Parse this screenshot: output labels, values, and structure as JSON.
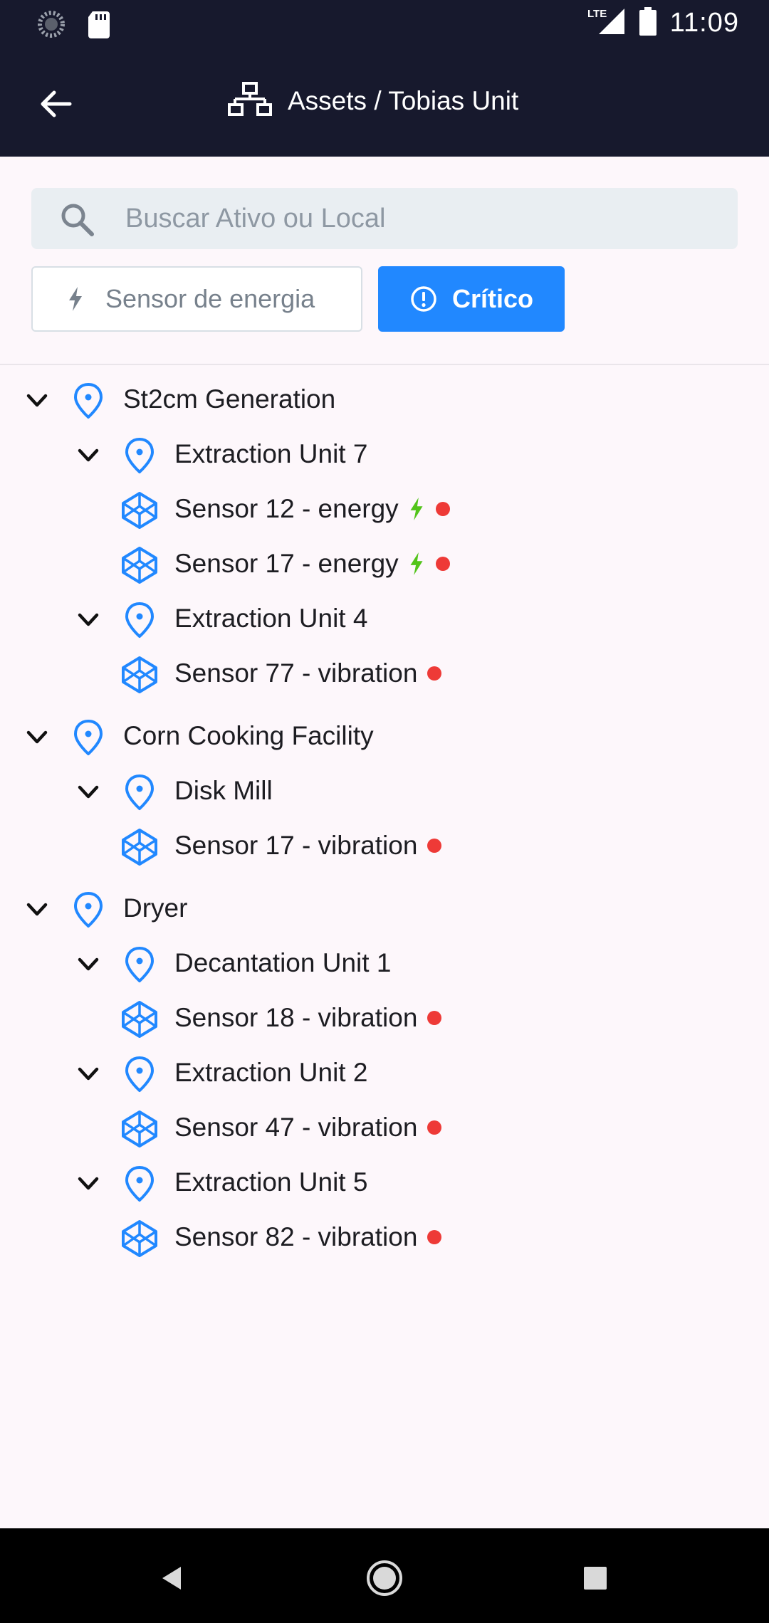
{
  "status_bar": {
    "time": "11:09",
    "network": "LTE",
    "icons": [
      "loading-icon",
      "sd-card-icon",
      "signal-icon",
      "battery-icon"
    ]
  },
  "app_bar": {
    "title": "Assets / Tobias Unit",
    "icons": [
      "back-arrow-icon",
      "hierarchy-icon"
    ]
  },
  "search": {
    "placeholder": "Buscar Ativo ou Local",
    "value": ""
  },
  "filters": {
    "energy_label": "Sensor de energia",
    "critical_label": "Crítico",
    "critical_active": true
  },
  "colors": {
    "header_bg": "#17192d",
    "accent": "#2188ff",
    "alert_red": "#ee3a37",
    "energy_green": "#52c41a",
    "page_bg": "#fdf7fb"
  },
  "tree": [
    {
      "label": "St2cm Generation",
      "type": "location",
      "expanded": true
    },
    {
      "label": "Extraction Unit 7",
      "type": "location",
      "expanded": true
    },
    {
      "label": "Sensor 12 - energy",
      "type": "component",
      "energy": true,
      "critical": true
    },
    {
      "label": "Sensor 17 - energy",
      "type": "component",
      "energy": true,
      "critical": true
    },
    {
      "label": "Extraction Unit 4",
      "type": "location",
      "expanded": true
    },
    {
      "label": "Sensor 77 - vibration",
      "type": "component",
      "energy": false,
      "critical": true
    },
    {
      "label": "Corn Cooking Facility",
      "type": "location",
      "expanded": true
    },
    {
      "label": "Disk Mill",
      "type": "location",
      "expanded": true
    },
    {
      "label": "Sensor 17 - vibration",
      "type": "component",
      "energy": false,
      "critical": true
    },
    {
      "label": "Dryer",
      "type": "location",
      "expanded": true
    },
    {
      "label": "Decantation Unit 1",
      "type": "location",
      "expanded": true
    },
    {
      "label": "Sensor 18 - vibration",
      "type": "component",
      "energy": false,
      "critical": true
    },
    {
      "label": "Extraction Unit 2",
      "type": "location",
      "expanded": true
    },
    {
      "label": "Sensor 47 - vibration",
      "type": "component",
      "energy": false,
      "critical": true
    },
    {
      "label": "Extraction Unit 5",
      "type": "location",
      "expanded": true
    },
    {
      "label": "Sensor 82 - vibration",
      "type": "component",
      "energy": false,
      "critical": true
    }
  ],
  "nav_bar": {
    "icons": [
      "back-triangle-icon",
      "home-circle-icon",
      "recents-square-icon"
    ]
  }
}
